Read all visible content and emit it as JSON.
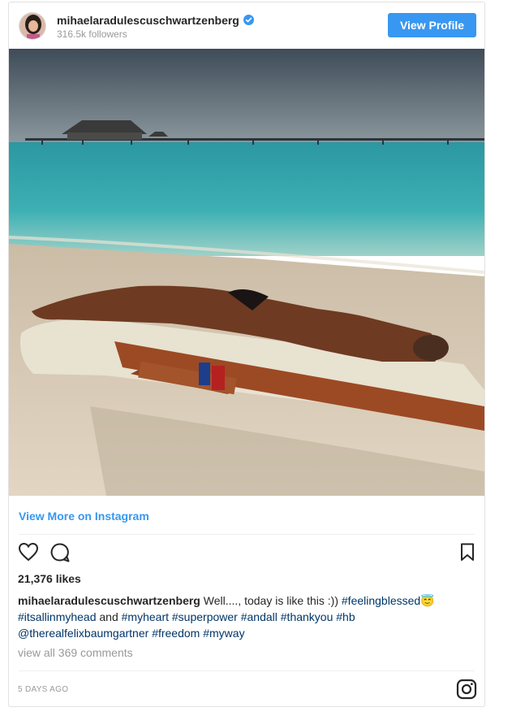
{
  "post": {
    "username": "mihaelaradulescuschwartzenberg",
    "followers": "316.5k followers",
    "view_profile_label": "View Profile",
    "view_more_label": "View More on Instagram",
    "likes": "21,376 likes",
    "caption": {
      "username": "mihaelaradulescuschwartzenberg",
      "text_1": " Well...., today is like this :)) ",
      "tag_1": "#feelingblessed",
      "emoji": "😇",
      "tag_2": "#itsallinmyhead",
      "text_2": " and ",
      "tag_3": "#myheart",
      "tag_4": "#superpower",
      "tag_5": "#andall",
      "tag_6": "#thankyou",
      "tag_7": "#hb",
      "mention": "@therealfelixbaumgartner",
      "tag_8": "#freedom",
      "tag_9": "#myway"
    },
    "comments_link": "view all 369 comments",
    "time_ago": "5 DAYS AGO"
  },
  "icons": {
    "verified": "verified-badge-icon",
    "like": "heart-icon",
    "comment": "comment-bubble-icon",
    "save": "bookmark-icon",
    "brand": "instagram-logo-icon"
  },
  "colors": {
    "accent": "#3897f0",
    "text": "#262626",
    "muted": "#999999",
    "hashtag": "#003569"
  }
}
